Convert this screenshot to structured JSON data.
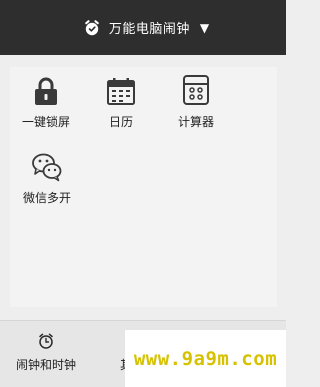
{
  "header": {
    "title": "万能电脑闹钟",
    "caret": "▼"
  },
  "tools": [
    {
      "label": "一键锁屏",
      "icon": "lock-icon"
    },
    {
      "label": "日历",
      "icon": "calendar-icon"
    },
    {
      "label": "计算器",
      "icon": "calculator-icon"
    },
    {
      "label": "微信多开",
      "icon": "wechat-icon"
    }
  ],
  "tabs": [
    {
      "label": "闹钟和时钟",
      "icon": "alarm-clock-icon"
    },
    {
      "label": "其"
    }
  ],
  "watermark": {
    "text": "www.9a9m.com"
  },
  "colors": {
    "header_bg": "#2e2e2e",
    "icon": "#3a3a3a",
    "watermark": "#d6c200"
  }
}
